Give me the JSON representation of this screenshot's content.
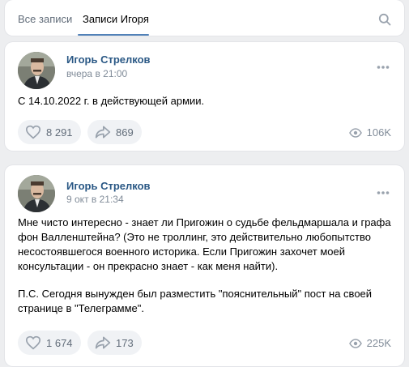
{
  "tabs": {
    "all_posts": "Все записи",
    "author_posts": "Записи Игоря"
  },
  "posts": [
    {
      "author": "Игорь Стрелков",
      "time": "вчера в 21:00",
      "text": "С 14.10.2022 г. в действующей армии.",
      "likes": "8 291",
      "shares": "869",
      "views": "106K"
    },
    {
      "author": "Игорь Стрелков",
      "time": "9 окт в 21:34",
      "text_p1": "Мне чисто интересно - знает ли Пригожин о судьбе фельдмаршала и графа фон Валленштейна? (Это не троллинг, это действительно любопытство несостоявшегося военного историка. Если Пригожин захочет моей консультации - он прекрасно знает - как меня найти).",
      "text_p2": "П.С. Сегодня вынужден был разместить \"пояснительный\" пост на своей странице в \"Телеграмме\".",
      "likes": "1 674",
      "shares": "173",
      "views": "225K"
    }
  ],
  "colors": {
    "link": "#2a5885",
    "accent": "#5181b8",
    "secondary": "#818c99",
    "background": "#edeef0"
  },
  "icons": [
    "search-icon",
    "more-icon",
    "heart-icon",
    "share-icon",
    "eye-icon"
  ]
}
